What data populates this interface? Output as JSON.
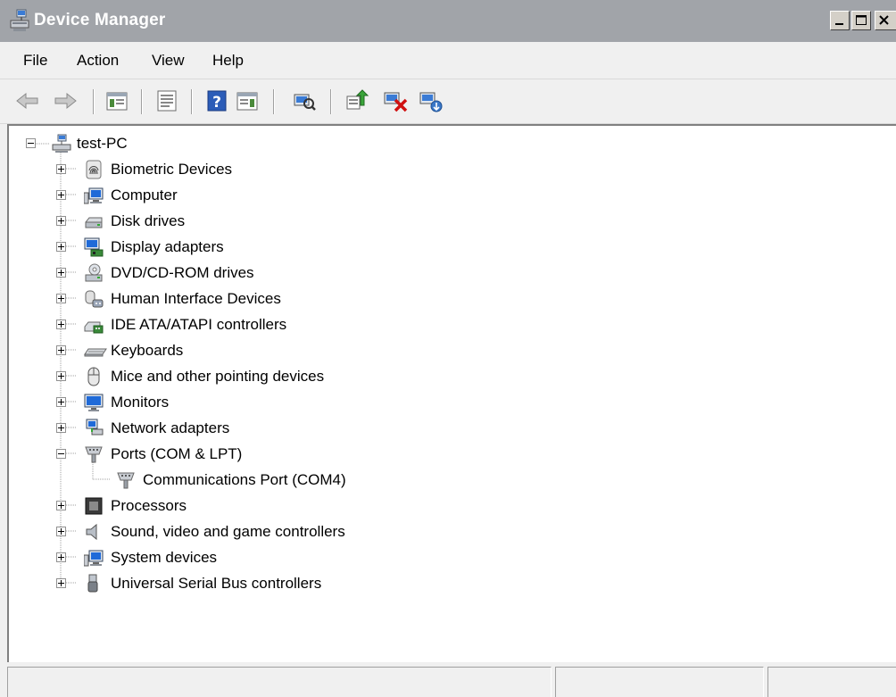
{
  "window": {
    "title": "Device Manager",
    "caption_buttons": [
      "minimize",
      "maximize",
      "close"
    ]
  },
  "menu": {
    "items": [
      {
        "label": "File"
      },
      {
        "label": "Action"
      },
      {
        "label": "View"
      },
      {
        "label": "Help"
      }
    ]
  },
  "toolbar": {
    "buttons": [
      {
        "icon": "back-arrow-icon"
      },
      {
        "icon": "forward-arrow-icon"
      },
      {
        "icon": "show-hide-console-tree-icon"
      },
      {
        "icon": "properties-icon"
      },
      {
        "icon": "help-icon"
      },
      {
        "icon": "show-action-pane-icon"
      },
      {
        "icon": "scan-hardware-changes-icon"
      },
      {
        "icon": "update-driver-icon"
      },
      {
        "icon": "uninstall-device-icon"
      },
      {
        "icon": "enable-device-icon"
      }
    ]
  },
  "tree": {
    "root": {
      "label": "test-PC",
      "expanded": true,
      "icon": "computer-network-icon"
    },
    "items": [
      {
        "label": "Biometric Devices",
        "icon": "fingerprint-icon",
        "expanded": false
      },
      {
        "label": "Computer",
        "icon": "computer-icon",
        "expanded": false
      },
      {
        "label": "Disk drives",
        "icon": "disk-drive-icon",
        "expanded": false
      },
      {
        "label": "Display adapters",
        "icon": "display-adapter-icon",
        "expanded": false
      },
      {
        "label": "DVD/CD-ROM drives",
        "icon": "dvd-drive-icon",
        "expanded": false
      },
      {
        "label": "Human Interface Devices",
        "icon": "hid-icon",
        "expanded": false
      },
      {
        "label": "IDE ATA/ATAPI controllers",
        "icon": "ide-controller-icon",
        "expanded": false
      },
      {
        "label": "Keyboards",
        "icon": "keyboard-icon",
        "expanded": false
      },
      {
        "label": "Mice and other pointing devices",
        "icon": "mouse-icon",
        "expanded": false
      },
      {
        "label": "Monitors",
        "icon": "monitor-icon",
        "expanded": false
      },
      {
        "label": "Network adapters",
        "icon": "network-adapter-icon",
        "expanded": false
      },
      {
        "label": "Ports (COM & LPT)",
        "icon": "port-icon",
        "expanded": true,
        "children": [
          {
            "label": "Communications Port (COM4)",
            "icon": "port-icon"
          }
        ]
      },
      {
        "label": "Processors",
        "icon": "processor-icon",
        "expanded": false
      },
      {
        "label": "Sound, video and game controllers",
        "icon": "speaker-icon",
        "expanded": false
      },
      {
        "label": "System devices",
        "icon": "computer-icon",
        "expanded": false
      },
      {
        "label": "Universal Serial Bus controllers",
        "icon": "usb-icon",
        "expanded": false
      }
    ]
  },
  "statusbar": {
    "panes": [
      "",
      "",
      ""
    ]
  },
  "colors": {
    "titlebar": "#a1a4a9",
    "chrome": "#f0f0f0",
    "tree_bg": "#ffffff",
    "tree_lines": "#a0a0a0"
  }
}
